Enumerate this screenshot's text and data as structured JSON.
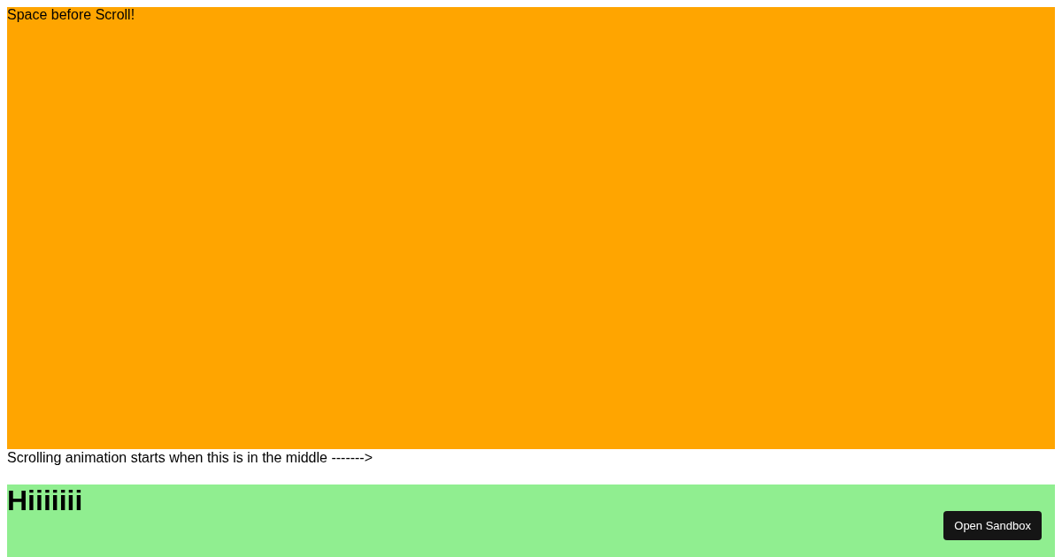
{
  "scroll_section": {
    "label": "Space before Scroll!"
  },
  "hint": "Scrolling animation starts when this is in the middle ------->",
  "animated_section": {
    "heading": "Hiiiiiii"
  },
  "button": "Open Sandbox"
}
